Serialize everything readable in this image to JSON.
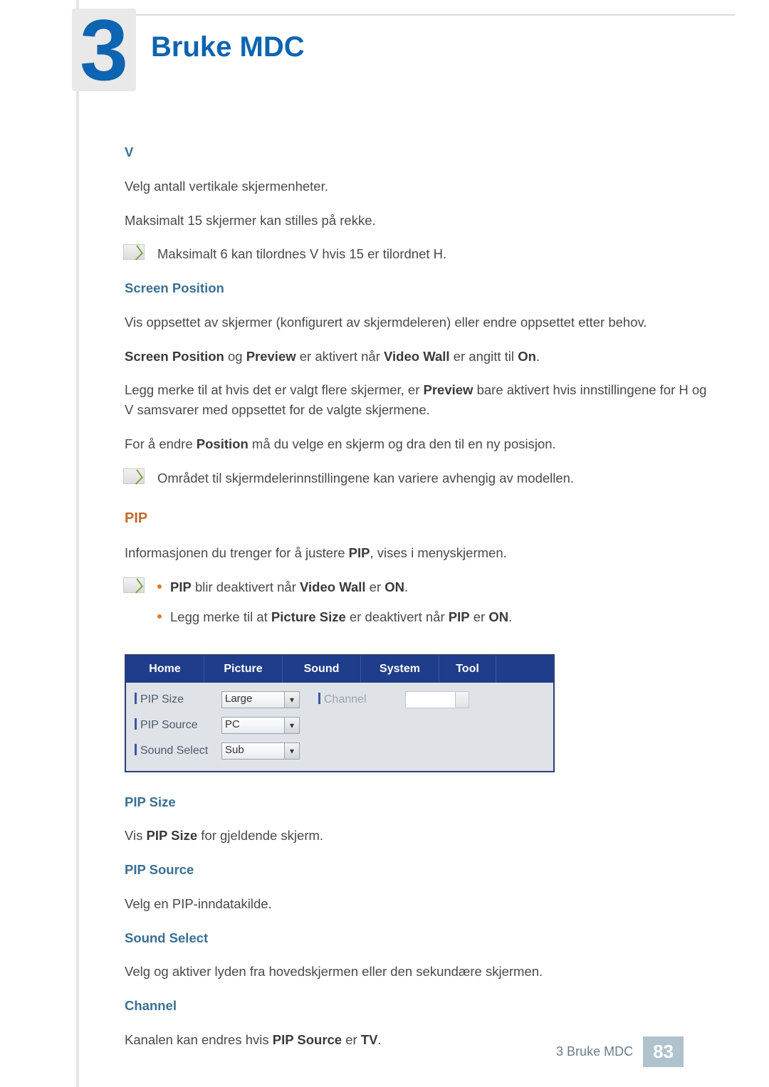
{
  "chapter": {
    "number": "3",
    "title": "Bruke MDC"
  },
  "v": {
    "heading": "V",
    "p1": "Velg antall vertikale skjermenheter.",
    "p2": "Maksimalt 15 skjermer kan stilles på rekke.",
    "note": "Maksimalt 6 kan tilordnes V hvis 15 er tilordnet H."
  },
  "screen_position": {
    "heading": "Screen Position",
    "p1": "Vis oppsettet av skjermer (konfigurert av skjermdeleren) eller endre oppsettet etter behov.",
    "p2_1": "Screen Position",
    "p2_2": " og ",
    "p2_3": "Preview",
    "p2_4": " er aktivert når ",
    "p2_5": "Video Wall",
    "p2_6": " er angitt til ",
    "p2_7": "On",
    "p2_8": ".",
    "p3_1": "Legg merke til at hvis det er valgt flere skjermer, er ",
    "p3_2": "Preview",
    "p3_3": " bare aktivert hvis innstillingene for H og V samsvarer med oppsettet for de valgte skjermene.",
    "p4_1": "For å endre ",
    "p4_2": "Position",
    "p4_3": " må du velge en skjerm og dra den til en ny posisjon.",
    "note": "Området til skjermdelerinnstillingene kan variere avhengig av modellen."
  },
  "pip": {
    "heading": "PIP",
    "intro_1": "Informasjonen du trenger for å justere ",
    "intro_2": "PIP",
    "intro_3": ", vises i menyskjermen.",
    "bullet1_1": "PIP",
    "bullet1_2": " blir deaktivert når ",
    "bullet1_3": "Video Wall",
    "bullet1_4": " er ",
    "bullet1_5": "ON",
    "bullet1_6": ".",
    "bullet2_1": "Legg merke til at ",
    "bullet2_2": "Picture Size",
    "bullet2_3": " er deaktivert når ",
    "bullet2_4": "PIP",
    "bullet2_5": " er ",
    "bullet2_6": "ON",
    "bullet2_7": "."
  },
  "panel": {
    "tabs": {
      "home": "Home",
      "picture": "Picture",
      "sound": "Sound",
      "system": "System",
      "tool": "Tool"
    },
    "rows": {
      "pip_size": {
        "label": "PIP Size",
        "value": "Large"
      },
      "pip_source": {
        "label": "PIP Source",
        "value": "PC"
      },
      "sound_select": {
        "label": "Sound Select",
        "value": "Sub"
      },
      "channel": {
        "label": "Channel",
        "value": ""
      }
    }
  },
  "defs": {
    "pip_size": {
      "heading": "PIP Size",
      "p_1": "Vis ",
      "p_2": "PIP Size",
      "p_3": " for gjeldende skjerm."
    },
    "pip_source": {
      "heading": "PIP Source",
      "p": "Velg en PIP-inndatakilde."
    },
    "sound_select": {
      "heading": "Sound Select",
      "p": "Velg og aktiver lyden fra hovedskjermen eller den sekundære skjermen."
    },
    "channel": {
      "heading": "Channel",
      "p_1": "Kanalen kan endres hvis ",
      "p_2": "PIP Source",
      "p_3": " er ",
      "p_4": "TV",
      "p_5": "."
    }
  },
  "footer": {
    "text": "3 Bruke MDC",
    "page": "83"
  }
}
